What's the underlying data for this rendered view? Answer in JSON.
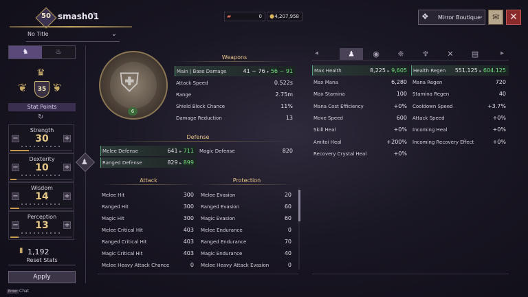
{
  "header": {
    "level": "50",
    "character_name": "smash01",
    "title_select": "No Title",
    "currency1": "0",
    "currency2": "4,207,958",
    "boutique_label": "Mirror Boutique"
  },
  "left_tabs": [
    "char-tab",
    "flame-tab"
  ],
  "stat_points": {
    "value": "35",
    "label": "Stat Points"
  },
  "stats": [
    {
      "name": "Strength",
      "value": "30",
      "fill": 0.3
    },
    {
      "name": "Dexterity",
      "value": "10",
      "fill": 0.1
    },
    {
      "name": "Wisdom",
      "value": "14",
      "fill": 0.14
    },
    {
      "name": "Perception",
      "value": "13",
      "fill": 0.13
    }
  ],
  "reset": {
    "count": "1,192",
    "label": "Reset Stats"
  },
  "apply_label": "Apply",
  "chat": {
    "key": "Enter",
    "label": "Chat"
  },
  "weapon": {
    "level": "6"
  },
  "weapons_section": {
    "title": "Weapons",
    "rows": [
      {
        "label": "Main | Base Damage",
        "base": "41 ~ 76",
        "new": "56 ~ 91"
      },
      {
        "label": "Attack Speed",
        "value": "0.522s"
      },
      {
        "label": "Range",
        "value": "2.75m"
      },
      {
        "label": "Shield Block Chance",
        "value": "11%"
      },
      {
        "label": "Damage Reduction",
        "value": "13"
      }
    ]
  },
  "defense_section": {
    "title": "Defense",
    "left": [
      {
        "label": "Melee Defense",
        "base": "641",
        "new": "711"
      },
      {
        "label": "Ranged Defense",
        "base": "829",
        "new": "899"
      }
    ],
    "right": [
      {
        "label": "Magic Defense",
        "value": "820"
      }
    ]
  },
  "attack_section": {
    "title": "Attack",
    "rows": [
      {
        "label": "Melee Hit",
        "value": "300"
      },
      {
        "label": "Ranged Hit",
        "value": "300"
      },
      {
        "label": "Magic Hit",
        "value": "300"
      },
      {
        "label": "Melee Critical Hit",
        "value": "403"
      },
      {
        "label": "Ranged Critical Hit",
        "value": "403"
      },
      {
        "label": "Magic Critical Hit",
        "value": "403"
      },
      {
        "label": "Melee Heavy Attack Chance",
        "value": "0"
      }
    ]
  },
  "protection_section": {
    "title": "Protection",
    "rows": [
      {
        "label": "Melee Evasion",
        "value": "20"
      },
      {
        "label": "Ranged Evasion",
        "value": "60"
      },
      {
        "label": "Magic Evasion",
        "value": "60"
      },
      {
        "label": "Melee Endurance",
        "value": "0"
      },
      {
        "label": "Ranged Endurance",
        "value": "70"
      },
      {
        "label": "Magic Endurance",
        "value": "40"
      },
      {
        "label": "Melee Heavy Attack Evasion",
        "value": "0"
      }
    ]
  },
  "right_tabs": [
    "character-icon",
    "eye-icon",
    "beast-icon",
    "horned-helm-icon",
    "crossed-swords-icon",
    "stack-icon"
  ],
  "right_left_col": [
    {
      "label": "Max Health",
      "base": "8,225",
      "new": "9,605",
      "hl": true
    },
    {
      "label": "Max Mana",
      "value": "6,280"
    },
    {
      "label": "Max Stamina",
      "value": "100"
    },
    {
      "label": "Mana Cost Efficiency",
      "value": "+0%"
    },
    {
      "label": "Move Speed",
      "value": "600"
    },
    {
      "label": "Skill Heal",
      "value": "+0%"
    },
    {
      "label": "Amitoi Heal",
      "value": "+200%"
    },
    {
      "label": "Recovery Crystal Heal",
      "value": "+0%"
    }
  ],
  "right_right_col": [
    {
      "label": "Health Regen",
      "base": "551.125",
      "new": "604.125",
      "hl": true
    },
    {
      "label": "Mana Regen",
      "value": "720"
    },
    {
      "label": "Stamina Regen",
      "value": "40"
    },
    {
      "label": "Cooldown Speed",
      "value": "+3.7%"
    },
    {
      "label": "Attack Speed",
      "value": "+0%"
    },
    {
      "label": "Incoming Heal",
      "value": "+0%"
    },
    {
      "label": "Incoming Recovery Effect",
      "value": "+0%"
    }
  ]
}
